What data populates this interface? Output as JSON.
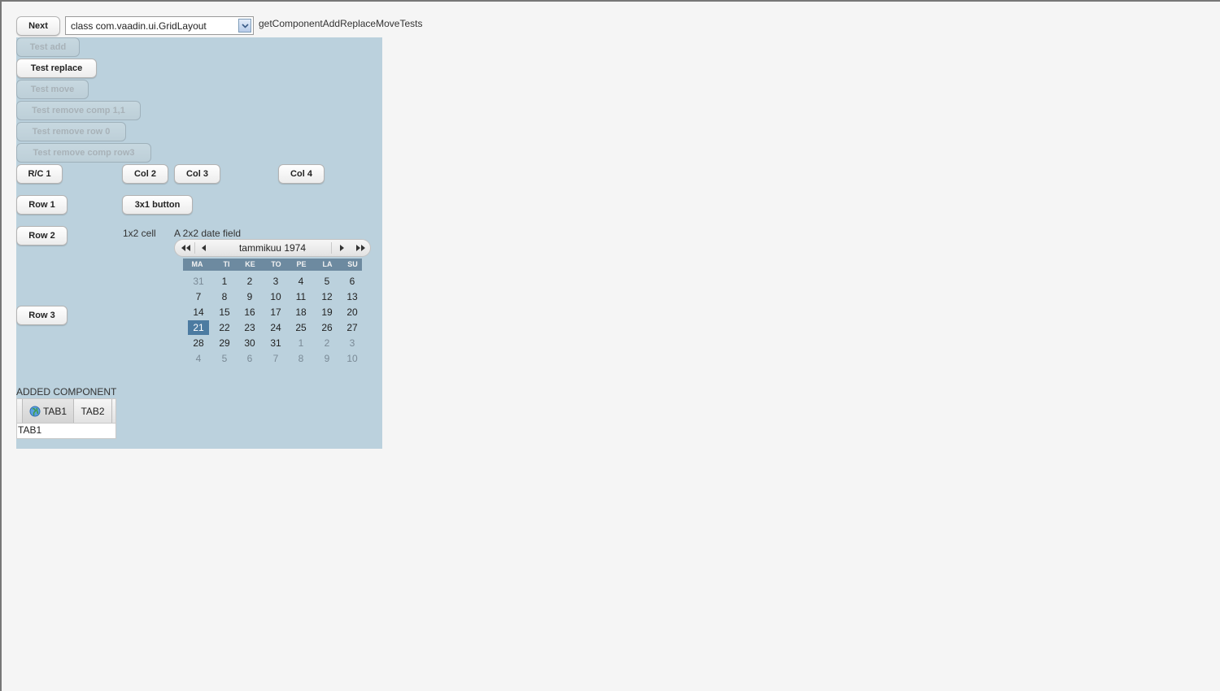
{
  "toolbar": {
    "next_label": "Next",
    "class_select_value": "class com.vaadin.ui.GridLayout",
    "test_name": "getComponentAddReplaceMoveTests"
  },
  "tests": [
    {
      "label": "Test add",
      "enabled": false
    },
    {
      "label": "Test replace",
      "enabled": true
    },
    {
      "label": "Test move",
      "enabled": false
    },
    {
      "label": "Test remove comp 1,1",
      "enabled": false
    },
    {
      "label": "Test remove row 0",
      "enabled": false
    },
    {
      "label": "Test remove comp row3",
      "enabled": false
    }
  ],
  "grid": {
    "rc1": "R/C 1",
    "col2": "Col 2",
    "col3": "Col 3",
    "col4": "Col 4",
    "row1": "Row 1",
    "button_3x1": "3x1 button",
    "row2": "Row 2",
    "cell_1x2": "1x2 cell",
    "date_caption": "A 2x2 date field",
    "row3": "Row 3"
  },
  "calendar": {
    "month_label": "tammikuu 1974",
    "weekdays": [
      "MA",
      "TI",
      "KE",
      "TO",
      "PE",
      "LA",
      "SU"
    ],
    "weeks": [
      [
        "31",
        "1",
        "2",
        "3",
        "4",
        "5",
        "6"
      ],
      [
        "7",
        "8",
        "9",
        "10",
        "11",
        "12",
        "13"
      ],
      [
        "14",
        "15",
        "16",
        "17",
        "18",
        "19",
        "20"
      ],
      [
        "21",
        "22",
        "23",
        "24",
        "25",
        "26",
        "27"
      ],
      [
        "28",
        "29",
        "30",
        "31",
        "1",
        "2",
        "3"
      ],
      [
        "4",
        "5",
        "6",
        "7",
        "8",
        "9",
        "10"
      ]
    ],
    "selected_day": "21"
  },
  "added": {
    "caption": "ADDED COMPONENT",
    "tabs": [
      "TAB1",
      "TAB2"
    ],
    "selected_tab": "TAB1",
    "content": "TAB1"
  },
  "icons": {
    "select_arrow": "chevron-down-icon",
    "prev_year": "double-left-icon",
    "prev_month": "left-icon",
    "next_month": "right-icon",
    "next_year": "double-right-icon",
    "tab_icon": "globe-icon"
  },
  "colors": {
    "grid_background": "#bbd1dd",
    "calendar_header": "#6d8aa0",
    "selected_day": "#4c7ba1"
  }
}
